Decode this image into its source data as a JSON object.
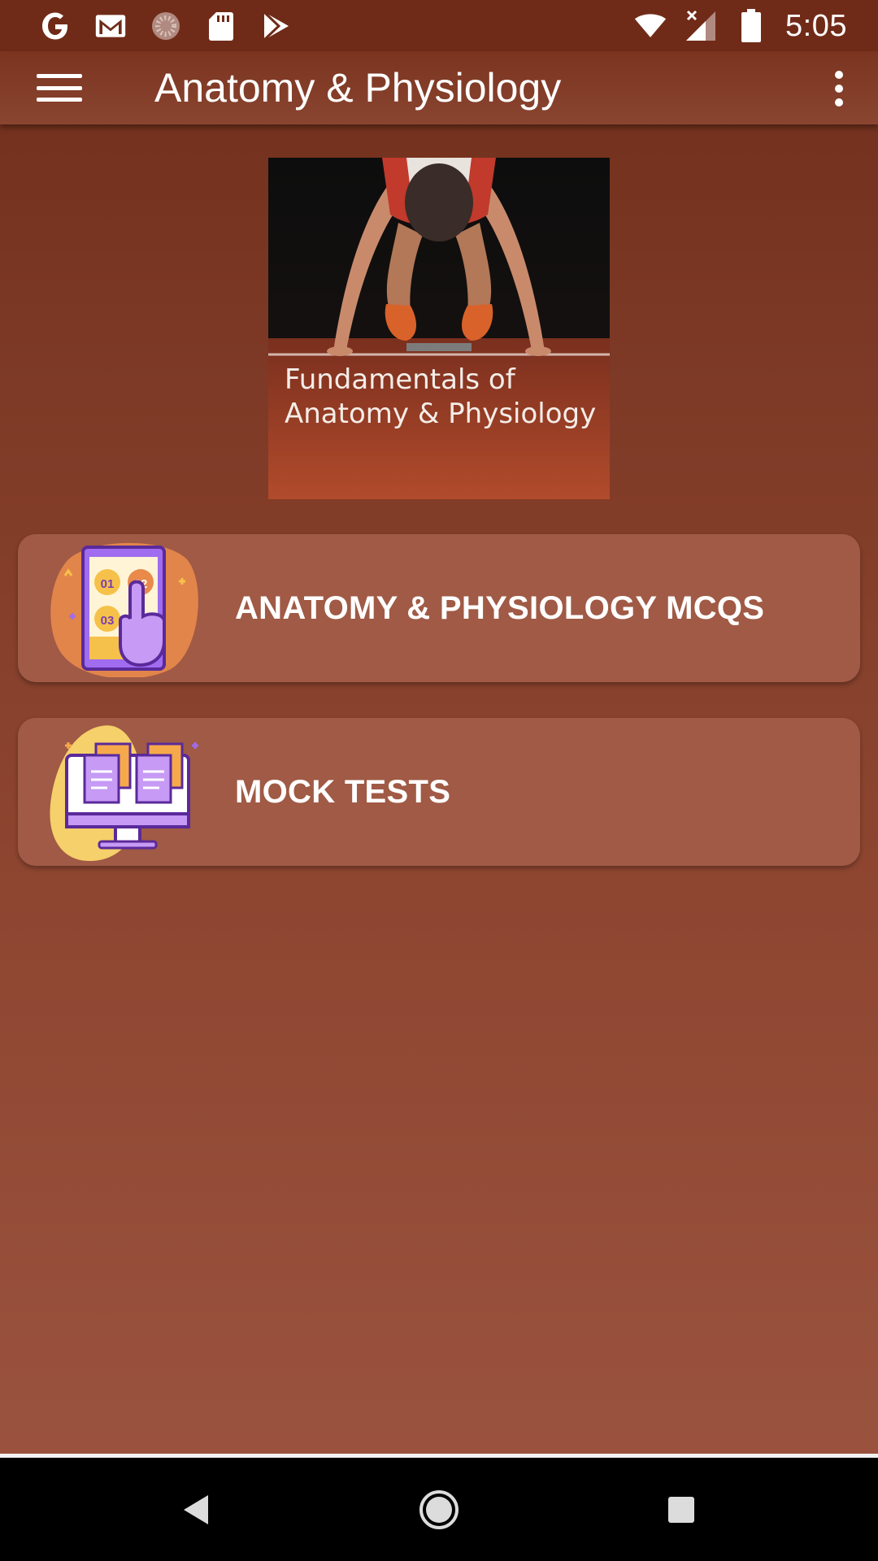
{
  "status_bar": {
    "time": "5:05",
    "left_icons": [
      "google-icon",
      "gmail-icon",
      "loading-circle-icon",
      "sd-card-icon",
      "play-store-icon"
    ],
    "right_icons": [
      "wifi-icon",
      "signal-no-data-icon",
      "battery-icon"
    ]
  },
  "app_bar": {
    "title": "Anatomy & Physiology",
    "menu_icon": "hamburger-menu-icon",
    "overflow_icon": "more-vert-icon"
  },
  "cover": {
    "line1": "Fundamentals of",
    "line2": "Anatomy & Physiology"
  },
  "menu_items": [
    {
      "label": "ANATOMY & PHYSIOLOGY MCQS",
      "icon": "mcq-phone-tap-icon"
    },
    {
      "label": "MOCK TESTS",
      "icon": "mock-test-monitor-icon"
    }
  ],
  "nav_bar": {
    "back_icon": "back-triangle-icon",
    "home_icon": "home-circle-icon",
    "recents_icon": "recents-square-icon"
  },
  "colors": {
    "status_bar": "#702b18",
    "background_top": "#6f2e1b",
    "background_bottom": "#9c5540",
    "card": "#a05a45",
    "accent_purple": "#a06cf0",
    "accent_orange": "#f08a3c"
  }
}
